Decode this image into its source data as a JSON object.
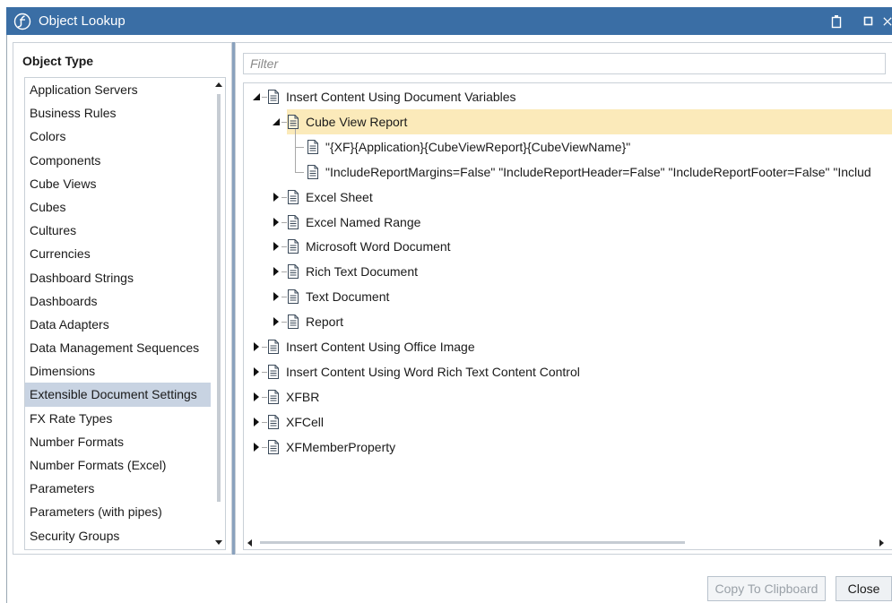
{
  "window": {
    "title": "Object Lookup"
  },
  "colors": {
    "titlebar": "#3a6ea5",
    "selection": "#c8d3e2",
    "highlight": "#fbeaba"
  },
  "left_panel": {
    "header": "Object Type",
    "items": [
      "Application Servers",
      "Business Rules",
      "Colors",
      "Components",
      "Cube Views",
      "Cubes",
      "Cultures",
      "Currencies",
      "Dashboard Strings",
      "Dashboards",
      "Data Adapters",
      "Data Management Sequences",
      "Dimensions",
      "Extensible Document Settings",
      "FX Rate Types",
      "Number Formats",
      "Number Formats (Excel)",
      "Parameters",
      "Parameters (with pipes)",
      "Security Groups"
    ],
    "selected": "Extensible Document Settings"
  },
  "right_panel": {
    "filter_placeholder": "Filter",
    "tree": [
      {
        "label": "Insert Content Using Document Variables",
        "level": 0,
        "expanded": true
      },
      {
        "label": "Cube View Report",
        "level": 1,
        "expanded": true,
        "highlighted": true
      },
      {
        "label": "\"{XF}{Application}{CubeViewReport}{CubeViewName}\"",
        "level": 2,
        "leaf": true
      },
      {
        "label": "\"IncludeReportMargins=False\" \"IncludeReportHeader=False\" \"IncludeReportFooter=False\" \"Includ",
        "level": 2,
        "leaf": true
      },
      {
        "label": "Excel Sheet",
        "level": 1,
        "expanded": false
      },
      {
        "label": "Excel Named Range",
        "level": 1,
        "expanded": false
      },
      {
        "label": "Microsoft Word Document",
        "level": 1,
        "expanded": false
      },
      {
        "label": "Rich Text Document",
        "level": 1,
        "expanded": false
      },
      {
        "label": "Text Document",
        "level": 1,
        "expanded": false
      },
      {
        "label": "Report",
        "level": 1,
        "expanded": false
      },
      {
        "label": "Insert Content Using Office Image",
        "level": 0,
        "expanded": false
      },
      {
        "label": "Insert Content Using Word Rich Text Content Control",
        "level": 0,
        "expanded": false
      },
      {
        "label": "XFBR",
        "level": 0,
        "expanded": false
      },
      {
        "label": "XFCell",
        "level": 0,
        "expanded": false
      },
      {
        "label": "XFMemberProperty",
        "level": 0,
        "expanded": false
      }
    ]
  },
  "buttons": {
    "copy": "Copy To Clipboard",
    "close": "Close"
  }
}
